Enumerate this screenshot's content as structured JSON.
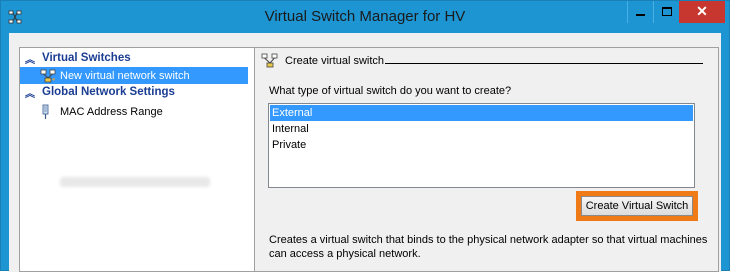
{
  "window": {
    "title": "Virtual Switch Manager for HV"
  },
  "controls": {
    "minimize": "minimize",
    "maximize": "maximize",
    "close": "✕"
  },
  "tree": {
    "virtual_switches_header": "Virtual Switches",
    "new_switch_item": "New virtual network switch",
    "global_settings_header": "Global Network Settings",
    "mac_range_item": "MAC Address Range"
  },
  "panel": {
    "section_title": "Create virtual switch",
    "question": "What type of virtual switch do you want to create?",
    "switch_types": [
      "External",
      "Internal",
      "Private"
    ],
    "selected_type": "External",
    "create_button": "Create Virtual Switch",
    "description": "Creates a virtual switch that binds to the physical network adapter so that virtual machines can access a physical network."
  },
  "colors": {
    "title_bar": "#1e95d3",
    "selection": "#3399ff",
    "highlight_ring": "#f07b16",
    "close_button": "#c7372f"
  }
}
